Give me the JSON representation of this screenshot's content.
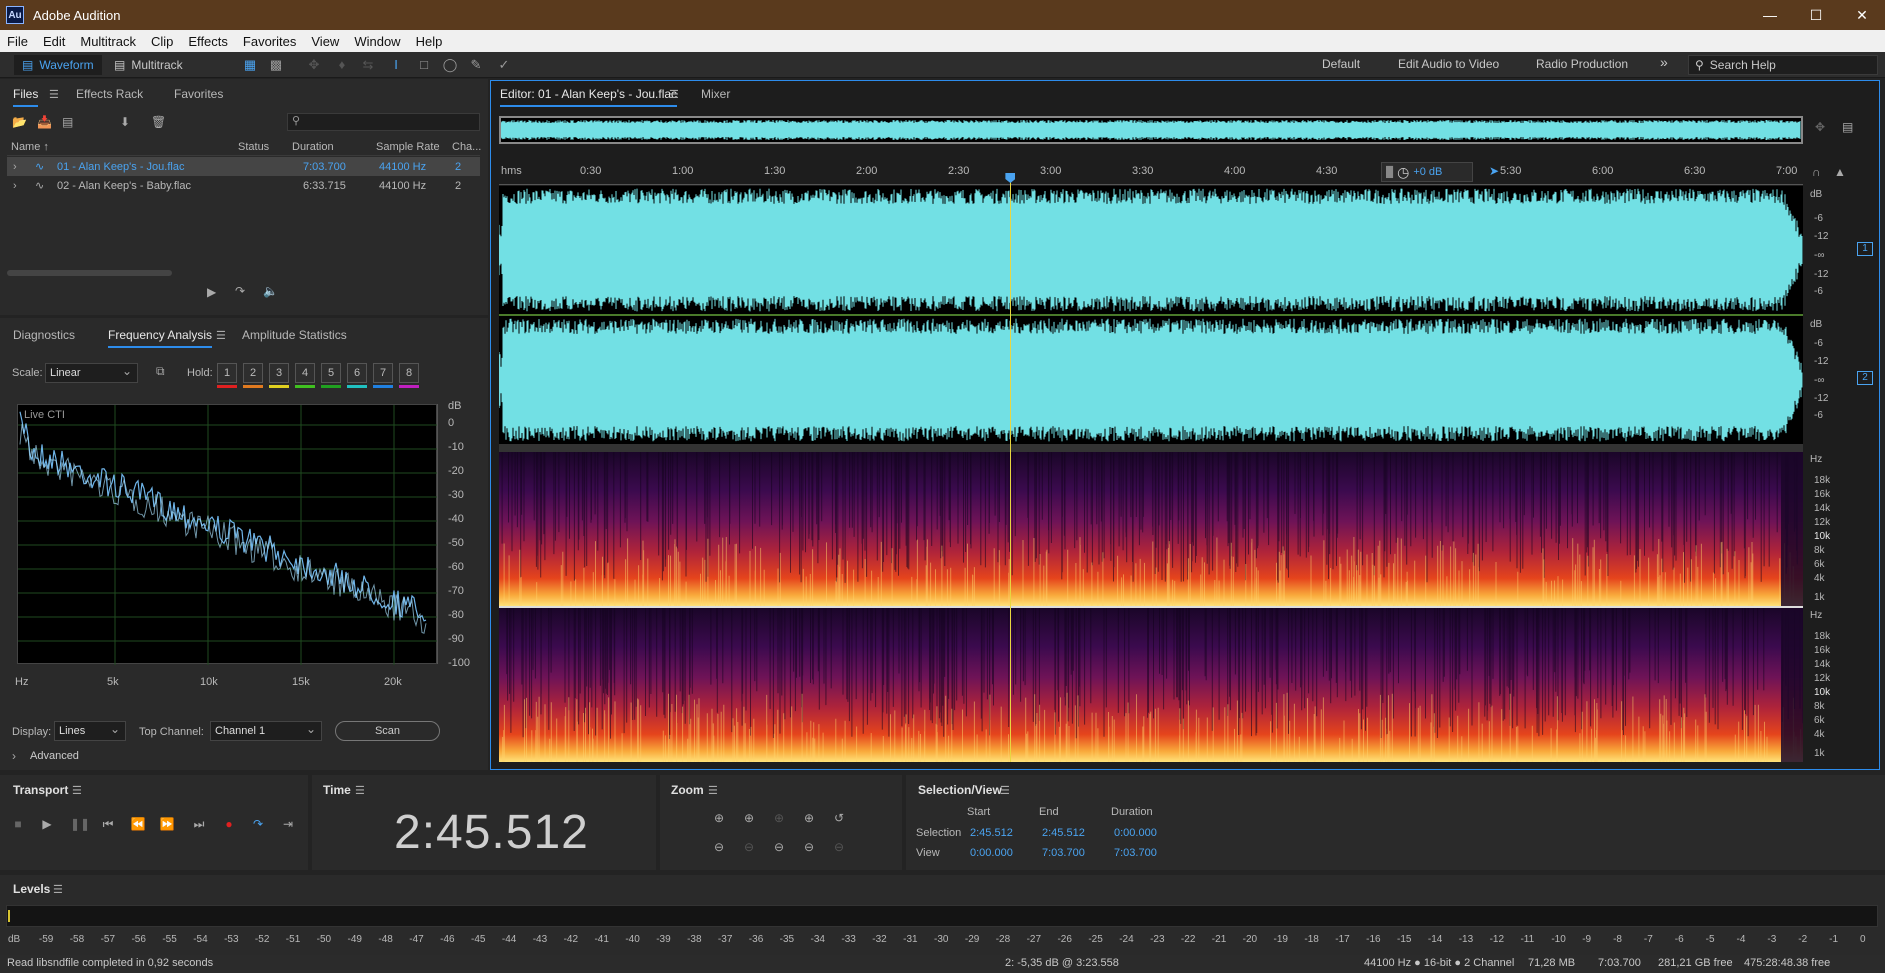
{
  "title_bar": {
    "logo": "Au",
    "title": "Adobe Audition"
  },
  "menu": [
    "File",
    "Edit",
    "Multitrack",
    "Clip",
    "Effects",
    "Favorites",
    "View",
    "Window",
    "Help"
  ],
  "toolbar": {
    "waveform_label": "Waveform",
    "multitrack_label": "Multitrack",
    "workspaces": [
      "Default",
      "Edit Audio to Video",
      "Radio Production"
    ],
    "more": "»",
    "search_placeholder": "Search Help"
  },
  "files_panel": {
    "tabs": [
      "Files",
      "Effects Rack",
      "Favorites"
    ],
    "columns": [
      "Name ↑",
      "Status",
      "Duration",
      "Sample Rate",
      "Cha..."
    ],
    "rows": [
      {
        "name": "01 - Alan Keep's - Jou.flac",
        "status": "",
        "duration": "7:03.700",
        "sample_rate": "44100 Hz",
        "channels": "2",
        "selected": true
      },
      {
        "name": "02 - Alan Keep's - Baby.flac",
        "status": "",
        "duration": "6:33.715",
        "sample_rate": "44100 Hz",
        "channels": "2",
        "selected": false
      }
    ]
  },
  "analysis_panel": {
    "tabs": [
      "Diagnostics",
      "Frequency Analysis",
      "Amplitude Statistics"
    ],
    "scale_label": "Scale:",
    "scale_value": "Linear",
    "hold_label": "Hold:",
    "hold_buttons": [
      "1",
      "2",
      "3",
      "4",
      "5",
      "6",
      "7",
      "8"
    ],
    "hold_colors": [
      "#e02020",
      "#e07a20",
      "#e0d020",
      "#40c020",
      "#20a020",
      "#20c0c0",
      "#2080e0",
      "#c020c0"
    ],
    "graph_label": "Live CTI",
    "db_unit": "dB",
    "db_ticks": [
      "0",
      "-10",
      "-20",
      "-30",
      "-40",
      "-50",
      "-60",
      "-70",
      "-80",
      "-90",
      "-100"
    ],
    "hz_ticks": [
      "Hz",
      "5k",
      "10k",
      "15k",
      "20k"
    ],
    "display_label": "Display:",
    "display_value": "Lines",
    "top_channel_label": "Top Channel:",
    "top_channel_value": "Channel 1",
    "scan_label": "Scan",
    "advanced_label": "Advanced"
  },
  "editor": {
    "tab_label": "Editor: 01 - Alan Keep's - Jou.flac",
    "mixer_label": "Mixer",
    "time_unit": "hms",
    "ruler_labels": [
      "0:30",
      "1:00",
      "1:30",
      "2:00",
      "2:30",
      "3:00",
      "3:30",
      "4:00",
      "4:30",
      "5:30",
      "6:00",
      "6:30",
      "7:00"
    ],
    "gain_label": "+0 dB",
    "db_ticks_wave": [
      "dB",
      "-6",
      "-12",
      "-∞",
      "-12",
      "-6"
    ],
    "channel_labels": [
      "1",
      "2"
    ],
    "hz_ticks_spec_1": [
      "Hz",
      "18k",
      "16k",
      "14k",
      "12k",
      "10k",
      "8k",
      "6k",
      "4k",
      "1k"
    ],
    "hz_ticks_spec_2": [
      "Hz",
      "18k",
      "16k",
      "14k",
      "12k",
      "10k",
      "8k",
      "6k",
      "4k",
      "1k"
    ],
    "playhead_fraction": 0.3914,
    "total_duration_s": 423.7,
    "waveform_color": "#72e0e4"
  },
  "transport": {
    "title": "Transport"
  },
  "time_panel": {
    "title": "Time",
    "value": "2:45.512"
  },
  "zoom_panel": {
    "title": "Zoom"
  },
  "selection_panel": {
    "title": "Selection/View",
    "headers": [
      "Start",
      "End",
      "Duration"
    ],
    "selection_label": "Selection",
    "selection_values": [
      "2:45.512",
      "2:45.512",
      "0:00.000"
    ],
    "view_label": "View",
    "view_values": [
      "0:00.000",
      "7:03.700",
      "7:03.700"
    ]
  },
  "levels_panel": {
    "title": "Levels",
    "ticks": [
      "dB",
      "-59",
      "-58",
      "-57",
      "-56",
      "-55",
      "-54",
      "-53",
      "-52",
      "-51",
      "-50",
      "-49",
      "-48",
      "-47",
      "-46",
      "-45",
      "-44",
      "-43",
      "-42",
      "-41",
      "-40",
      "-39",
      "-38",
      "-37",
      "-36",
      "-35",
      "-34",
      "-33",
      "-32",
      "-31",
      "-30",
      "-29",
      "-28",
      "-27",
      "-26",
      "-25",
      "-24",
      "-23",
      "-22",
      "-21",
      "-20",
      "-19",
      "-18",
      "-17",
      "-16",
      "-15",
      "-14",
      "-13",
      "-12",
      "-11",
      "-10",
      "-9",
      "-8",
      "-7",
      "-6",
      "-5",
      "-4",
      "-3",
      "-2",
      "-1",
      "0"
    ]
  },
  "status_bar": {
    "message": "Read libsndfile completed in 0,92 seconds",
    "cursor_info": "2: -5,35 dB @ 3:23.558",
    "format": "44100 Hz ● 16-bit ● 2 Channel",
    "size": "71,28 MB",
    "duration": "7:03.700",
    "free_space": "281,21 GB free",
    "free_time": "475:28:48.38 free"
  }
}
